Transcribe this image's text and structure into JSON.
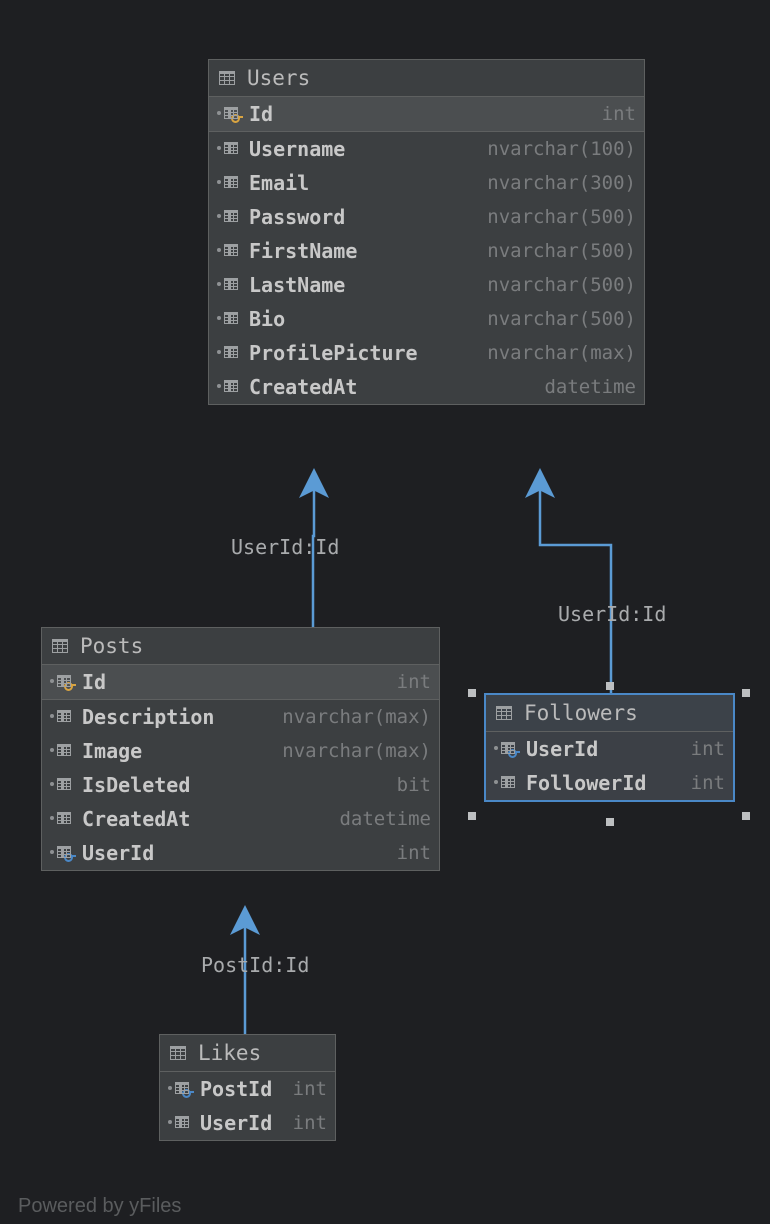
{
  "footer": "Powered by yFiles",
  "tables": {
    "users": {
      "title": "Users",
      "columns": [
        {
          "name": "Id",
          "type": "int",
          "pk": true,
          "key": "gold"
        },
        {
          "name": "Username",
          "type": "nvarchar(100)"
        },
        {
          "name": "Email",
          "type": "nvarchar(300)"
        },
        {
          "name": "Password",
          "type": "nvarchar(500)"
        },
        {
          "name": "FirstName",
          "type": "nvarchar(500)"
        },
        {
          "name": "LastName",
          "type": "nvarchar(500)"
        },
        {
          "name": "Bio",
          "type": "nvarchar(500)"
        },
        {
          "name": "ProfilePicture",
          "type": "nvarchar(max)"
        },
        {
          "name": "CreatedAt",
          "type": "datetime"
        }
      ]
    },
    "posts": {
      "title": "Posts",
      "columns": [
        {
          "name": "Id",
          "type": "int",
          "pk": true,
          "key": "gold"
        },
        {
          "name": "Description",
          "type": "nvarchar(max)"
        },
        {
          "name": "Image",
          "type": "nvarchar(max)"
        },
        {
          "name": "IsDeleted",
          "type": "bit"
        },
        {
          "name": "CreatedAt",
          "type": "datetime"
        },
        {
          "name": "UserId",
          "type": "int",
          "key": "blue"
        }
      ]
    },
    "followers": {
      "title": "Followers",
      "columns": [
        {
          "name": "UserId",
          "type": "int",
          "pk": true,
          "key": "blue"
        },
        {
          "name": "FollowerId",
          "type": "int",
          "pk": true
        }
      ]
    },
    "likes": {
      "title": "Likes",
      "columns": [
        {
          "name": "PostId",
          "type": "int",
          "pk": true,
          "key": "blue"
        },
        {
          "name": "UserId",
          "type": "int",
          "pk": true
        }
      ]
    }
  },
  "edges": {
    "posts_users": {
      "label": "UserId:Id"
    },
    "followers_users": {
      "label": "UserId:Id"
    },
    "likes_posts": {
      "label": "PostId:Id"
    }
  }
}
